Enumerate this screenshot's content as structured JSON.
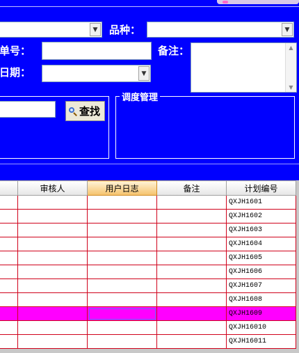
{
  "filters": {
    "variety_label": "品种：",
    "order_no_label": "单号：",
    "remark_label": "备注：",
    "date_label": "日期：",
    "search_button": "查找"
  },
  "dispatch_group": {
    "title": "调度管理"
  },
  "grid": {
    "columns": [
      "审核人",
      "用户日志",
      "备注",
      "计划编号"
    ],
    "active_column": "用户日志",
    "rows": [
      {
        "plan_no": "QXJH1601"
      },
      {
        "plan_no": "QXJH1602"
      },
      {
        "plan_no": "QXJH1603"
      },
      {
        "plan_no": "QXJH1604"
      },
      {
        "plan_no": "QXJH1605"
      },
      {
        "plan_no": "QXJH1606"
      },
      {
        "plan_no": "QXJH1607"
      },
      {
        "plan_no": "QXJH1608"
      },
      {
        "plan_no": "QXJH1609"
      },
      {
        "plan_no": "QXJH16010"
      },
      {
        "plan_no": "QXJH16011"
      }
    ],
    "selected_row": 8
  },
  "colors": {
    "background": "#0000ff",
    "grid_border": "#d0021b",
    "selected_row": "#ff00ff",
    "active_header": "#f5c26b"
  }
}
